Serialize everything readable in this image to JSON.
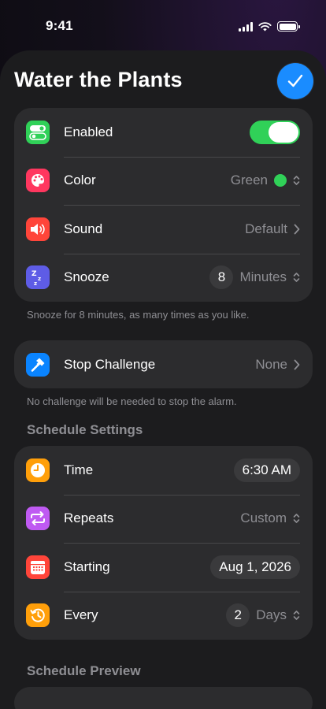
{
  "status_bar": {
    "time": "9:41"
  },
  "header": {
    "title": "Water the Plants"
  },
  "colors": {
    "accent": "#1a8cff",
    "toggle_on": "#30d158",
    "selected_color": "#30d158"
  },
  "alarm_settings": {
    "enabled": {
      "label": "Enabled",
      "value": true,
      "icon": "toggle-icon",
      "icon_color": "#30d158"
    },
    "color": {
      "label": "Color",
      "value": "Green",
      "icon": "palette-icon",
      "icon_color": "#ff375f"
    },
    "sound": {
      "label": "Sound",
      "value": "Default",
      "icon": "speaker-icon",
      "icon_color": "#ff453a"
    },
    "snooze": {
      "label": "Snooze",
      "amount": "8",
      "unit": "Minutes",
      "icon": "zzz-icon",
      "icon_color": "#5e5ce6"
    },
    "footnote": "Snooze for 8 minutes, as many times as you like."
  },
  "challenge": {
    "label": "Stop Challenge",
    "value": "None",
    "icon": "hammer-icon",
    "icon_color": "#0a84ff",
    "footnote": "No challenge will be needed to stop the alarm."
  },
  "schedule": {
    "header": "Schedule Settings",
    "time": {
      "label": "Time",
      "value": "6:30 AM",
      "icon": "clock-icon",
      "icon_color": "#ff9f0a"
    },
    "repeats": {
      "label": "Repeats",
      "value": "Custom",
      "icon": "repeat-icon",
      "icon_color": "#bf5af2"
    },
    "starting": {
      "label": "Starting",
      "value": "Aug 1, 2026",
      "icon": "calendar-icon",
      "icon_color": "#ff453a"
    },
    "every": {
      "label": "Every",
      "amount": "2",
      "unit": "Days",
      "icon": "history-icon",
      "icon_color": "#ff9f0a"
    }
  },
  "preview": {
    "header": "Schedule Preview"
  }
}
